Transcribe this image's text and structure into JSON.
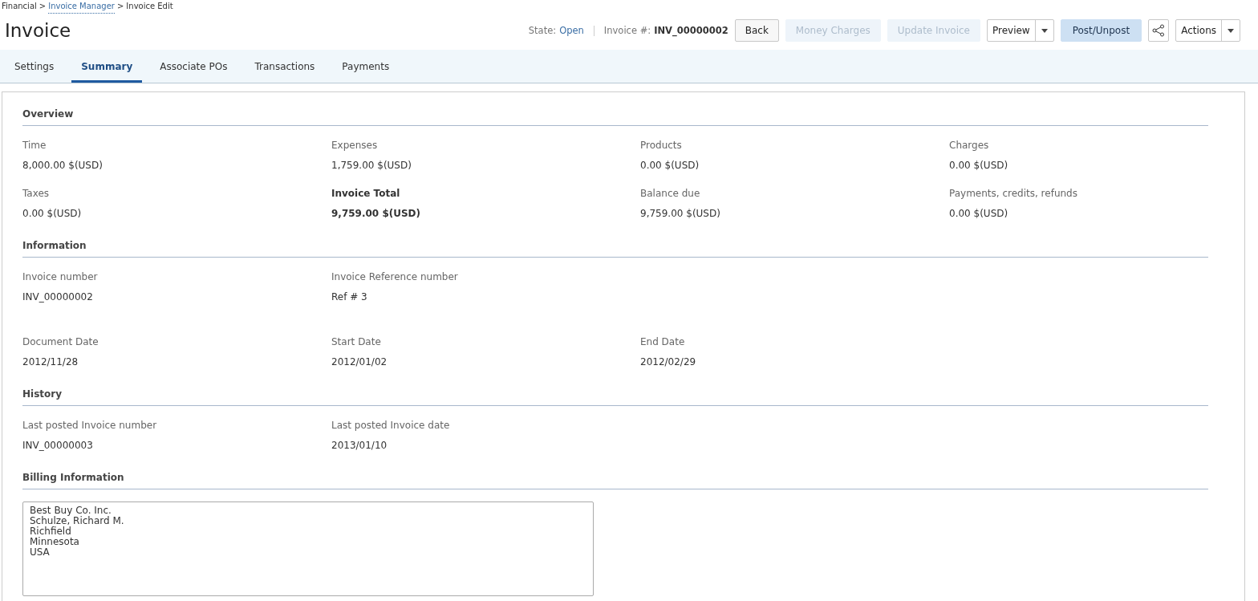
{
  "breadcrumb": [
    {
      "label": "Financial",
      "link": false
    },
    {
      "label": "Invoice Manager",
      "link": true
    },
    {
      "label": "Invoice Edit",
      "link": false
    }
  ],
  "breadcrumb_separator": ">",
  "title": "Invoice",
  "state": {
    "label": "State:",
    "value": "Open"
  },
  "invoice_number": {
    "label": "Invoice #:",
    "value": "INV_00000002"
  },
  "buttons": [
    {
      "kind": "default",
      "label": "Back",
      "disabled": false
    },
    {
      "kind": "default",
      "label": "Money Charges",
      "disabled": true
    },
    {
      "kind": "default",
      "label": "Update Invoice",
      "disabled": true
    },
    {
      "kind": "split",
      "label": "Preview",
      "disabled": false
    },
    {
      "kind": "primary",
      "label": "Post/Unpost",
      "disabled": false
    },
    {
      "kind": "share",
      "disabled": false
    },
    {
      "kind": "split",
      "label": "Actions",
      "disabled": false
    }
  ],
  "tabs": [
    {
      "label": "Settings",
      "selected": false
    },
    {
      "label": "Summary",
      "selected": true
    },
    {
      "label": "Associate POs",
      "selected": false
    },
    {
      "label": "Transactions",
      "selected": false
    },
    {
      "label": "Payments",
      "selected": false
    }
  ],
  "sections": [
    {
      "title": "Overview",
      "fields": [
        {
          "label": "Time",
          "value": "8,000.00 $(USD)",
          "bold": false
        },
        {
          "label": "Expenses",
          "value": "1,759.00 $(USD)",
          "bold": false
        },
        {
          "label": "Products",
          "value": "0.00 $(USD)",
          "bold": false
        },
        {
          "label": "Charges",
          "value": "0.00 $(USD)",
          "bold": false
        },
        {
          "label": "Taxes",
          "value": "0.00 $(USD)",
          "bold": false
        },
        {
          "label": "Invoice Total",
          "value": "9,759.00 $(USD)",
          "bold": true
        },
        {
          "label": "Balance due",
          "value": "9,759.00 $(USD)",
          "bold": false
        },
        {
          "label": "Payments, credits, refunds",
          "value": "0.00 $(USD)",
          "bold": false
        }
      ]
    },
    {
      "title": "Information",
      "fields": [
        {
          "label": "Invoice number",
          "value": "INV_00000002",
          "bold": false
        },
        {
          "label": "Invoice Reference number",
          "value": "Ref # 3",
          "bold": false
        },
        {
          "kind": "break"
        },
        {
          "label": "Document Date",
          "value": "2012/11/28",
          "bold": false
        },
        {
          "label": "Start Date",
          "value": "2012/01/02",
          "bold": false
        },
        {
          "label": "End Date",
          "value": "2012/02/29",
          "bold": false
        }
      ]
    },
    {
      "title": "History",
      "fields": [
        {
          "label": "Last posted Invoice number",
          "value": "INV_00000003",
          "bold": false
        },
        {
          "label": "Last posted Invoice date",
          "value": "2013/01/10",
          "bold": false
        }
      ]
    },
    {
      "title": "Billing Information",
      "billing_address": "Best Buy Co. Inc.\nSchulze, Richard M.\nRichfield\nMinnesota\nUSA"
    }
  ]
}
